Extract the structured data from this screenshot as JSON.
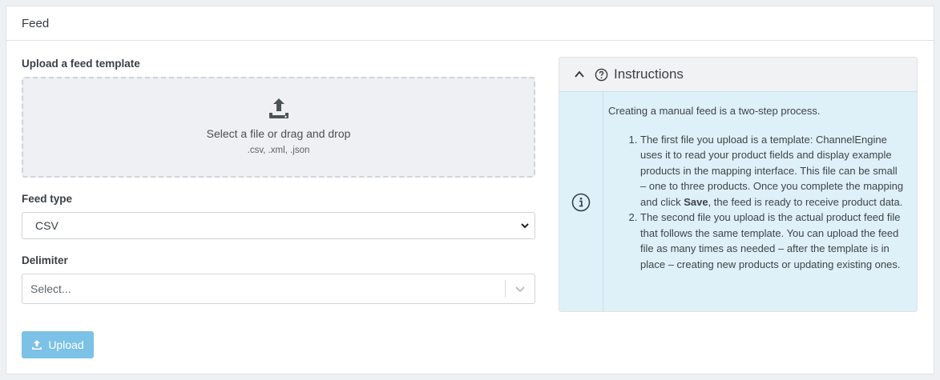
{
  "card": {
    "title": "Feed"
  },
  "upload": {
    "label": "Upload a feed template",
    "dropzone_text": "Select a file or drag and drop",
    "dropzone_types": ".csv, .xml, .json",
    "icon": "upload-tray-icon"
  },
  "feed_type": {
    "label": "Feed type",
    "value": "CSV"
  },
  "delimiter": {
    "label": "Delimiter",
    "placeholder": "Select..."
  },
  "upload_button": {
    "label": "Upload",
    "color": "#7cc1e6"
  },
  "instructions": {
    "title": "Instructions",
    "intro": "Creating a manual feed is a two-step process.",
    "step1_before": "The first file you upload is a template: ChannelEngine uses it to read your product fields and display example products in the mapping interface. This file can be small – one to three products. Once you complete the mapping and click ",
    "step1_bold": "Save",
    "step1_after": ", the feed is ready to receive product data.",
    "step2": "The second file you upload is the actual product feed file that follows the same template. You can upload the feed file as many times as needed – after the template is in place – creating new products or updating existing ones.",
    "background": "#dff1f8"
  }
}
